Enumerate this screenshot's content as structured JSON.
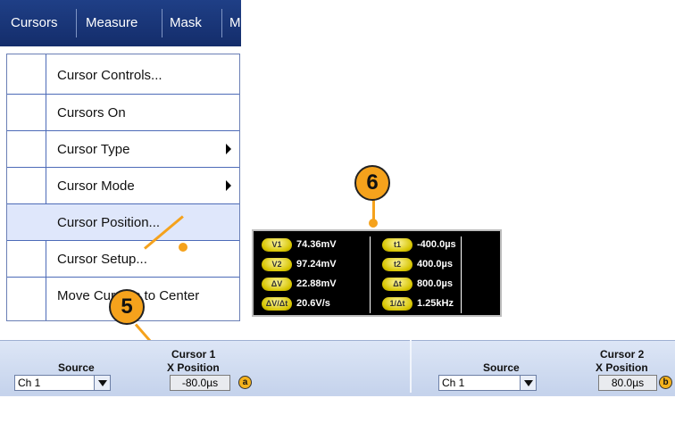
{
  "menubar": {
    "tabs": [
      {
        "label": "Cursors"
      },
      {
        "label": "Measure"
      },
      {
        "label": "Mask"
      },
      {
        "label": "M"
      }
    ]
  },
  "cursors_menu": {
    "items": [
      {
        "label": "Cursor Controls...",
        "submenu": false,
        "highlighted": false
      },
      {
        "label": "Cursors On",
        "submenu": false,
        "highlighted": false
      },
      {
        "label": "Cursor Type",
        "submenu": true,
        "highlighted": false
      },
      {
        "label": "Cursor Mode",
        "submenu": true,
        "highlighted": false
      },
      {
        "label": "Cursor Position...",
        "submenu": false,
        "highlighted": true
      },
      {
        "label": "Cursor Setup...",
        "submenu": false,
        "highlighted": false
      },
      {
        "label": "Move Cursors to Center",
        "submenu": false,
        "highlighted": false
      }
    ]
  },
  "readout": {
    "left": [
      {
        "badge": "V1",
        "value": "74.36mV"
      },
      {
        "badge": "V2",
        "value": "97.24mV"
      },
      {
        "badge": "ΔV",
        "value": "22.88mV"
      },
      {
        "badge": "ΔV/Δt",
        "value": "20.6V/s"
      }
    ],
    "right": [
      {
        "badge": "t1",
        "value": "-400.0µs"
      },
      {
        "badge": "t2",
        "value": "400.0µs"
      },
      {
        "badge": "Δt",
        "value": "800.0µs"
      },
      {
        "badge": "1/Δt",
        "value": "1.25kHz"
      }
    ]
  },
  "callouts": {
    "five": "5",
    "six": "6"
  },
  "panel": {
    "cursor1": {
      "title": "Cursor 1",
      "source_label": "Source",
      "source_value": "Ch 1",
      "xpos_label": "X Position",
      "xpos_value": "-80.0µs",
      "badge": "a"
    },
    "cursor2": {
      "title": "Cursor 2",
      "source_label": "Source",
      "source_value": "Ch 1",
      "xpos_label": "X Position",
      "xpos_value": "80.0µs",
      "badge": "b"
    }
  },
  "colors": {
    "menubar": "#1a3678",
    "callout": "#f5a21c",
    "highlight": "#dfe7fb",
    "readout_badge": "#d6c400"
  },
  "icons": {
    "submenu": "submenu-arrow-icon",
    "dropdown": "dropdown-arrow-icon"
  }
}
